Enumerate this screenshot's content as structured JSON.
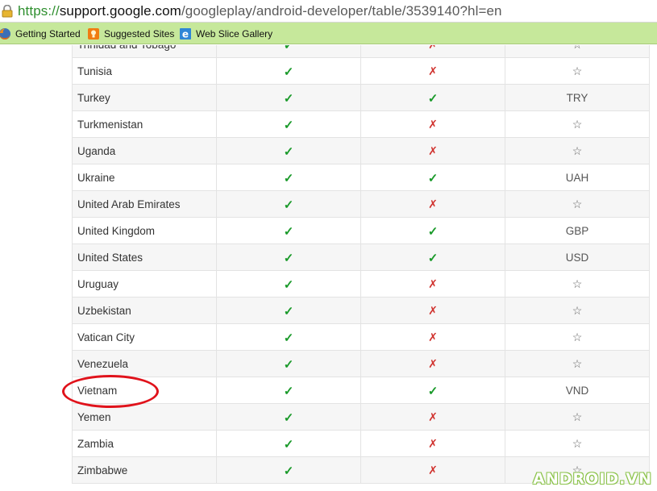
{
  "browser": {
    "url_scheme": "https://",
    "url_host": "support.google.com",
    "url_path": "/googleplay/android-developer/table/3539140?hl=en",
    "bookmarks": [
      {
        "label": "Getting Started",
        "icon": "firefox-icon"
      },
      {
        "label": "Suggested Sites",
        "icon": "suggested-sites-icon"
      },
      {
        "label": "Web Slice Gallery",
        "icon": "web-slice-icon"
      }
    ],
    "bookmark_bar_color": "#c6e89b"
  },
  "table": {
    "rows": [
      {
        "country": "Trinidad and Tobago",
        "col2": "✓",
        "col3": "✗",
        "col4": "☆"
      },
      {
        "country": "Tunisia",
        "col2": "✓",
        "col3": "✗",
        "col4": "☆"
      },
      {
        "country": "Turkey",
        "col2": "✓",
        "col3": "✓",
        "col4": "TRY"
      },
      {
        "country": "Turkmenistan",
        "col2": "✓",
        "col3": "✗",
        "col4": "☆"
      },
      {
        "country": "Uganda",
        "col2": "✓",
        "col3": "✗",
        "col4": "☆"
      },
      {
        "country": "Ukraine",
        "col2": "✓",
        "col3": "✓",
        "col4": "UAH"
      },
      {
        "country": "United Arab Emirates",
        "col2": "✓",
        "col3": "✗",
        "col4": "☆"
      },
      {
        "country": "United Kingdom",
        "col2": "✓",
        "col3": "✓",
        "col4": "GBP"
      },
      {
        "country": "United States",
        "col2": "✓",
        "col3": "✓",
        "col4": "USD"
      },
      {
        "country": "Uruguay",
        "col2": "✓",
        "col3": "✗",
        "col4": "☆"
      },
      {
        "country": "Uzbekistan",
        "col2": "✓",
        "col3": "✗",
        "col4": "☆"
      },
      {
        "country": "Vatican City",
        "col2": "✓",
        "col3": "✗",
        "col4": "☆"
      },
      {
        "country": "Venezuela",
        "col2": "✓",
        "col3": "✗",
        "col4": "☆"
      },
      {
        "country": "Vietnam",
        "col2": "✓",
        "col3": "✓",
        "col4": "VND"
      },
      {
        "country": "Yemen",
        "col2": "✓",
        "col3": "✗",
        "col4": "☆"
      },
      {
        "country": "Zambia",
        "col2": "✓",
        "col3": "✗",
        "col4": "☆"
      },
      {
        "country": "Zimbabwe",
        "col2": "✓",
        "col3": "✗",
        "col4": "☆"
      }
    ],
    "check_color": "#1a9a2a",
    "cross_color": "#d0312d"
  },
  "annotation": {
    "highlighted_row": "Vietnam",
    "color": "#e0121b"
  },
  "watermark": {
    "text": "ANDROID.VN"
  }
}
